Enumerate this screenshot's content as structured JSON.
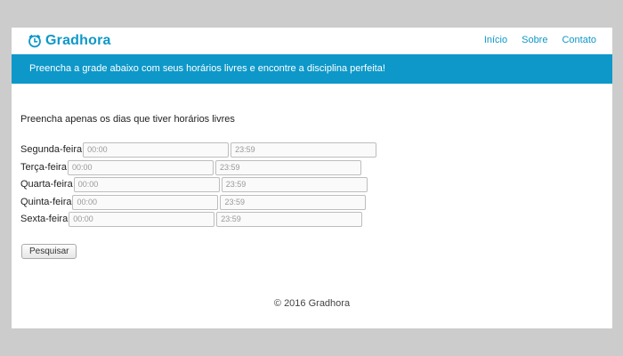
{
  "nav": {
    "brand": "Gradhora",
    "links": [
      "Início",
      "Sobre",
      "Contato"
    ],
    "brand_color": "#0d98c9"
  },
  "banner": {
    "text": "Preencha a grade abaixo com seus horários livres e encontre a disciplina perfeita!",
    "color": "#0d98c9"
  },
  "form": {
    "instruction": "Preencha apenas os dias que tiver horários livres",
    "days": [
      {
        "label": "Segunda-feira",
        "start_placeholder": "00:00",
        "end_placeholder": "23:59"
      },
      {
        "label": "Terça-feira",
        "start_placeholder": "00:00",
        "end_placeholder": "23:59"
      },
      {
        "label": "Quarta-feira",
        "start_placeholder": "00:00",
        "end_placeholder": "23:59"
      },
      {
        "label": "Quinta-feira",
        "start_placeholder": "00:00",
        "end_placeholder": "23:59"
      },
      {
        "label": "Sexta-feira",
        "start_placeholder": "00:00",
        "end_placeholder": "23:59"
      }
    ],
    "submit_label": "Pesquisar"
  },
  "footer": {
    "text": "© 2016 Gradhora"
  },
  "icons": {
    "brand_icon": "clock-icon"
  }
}
